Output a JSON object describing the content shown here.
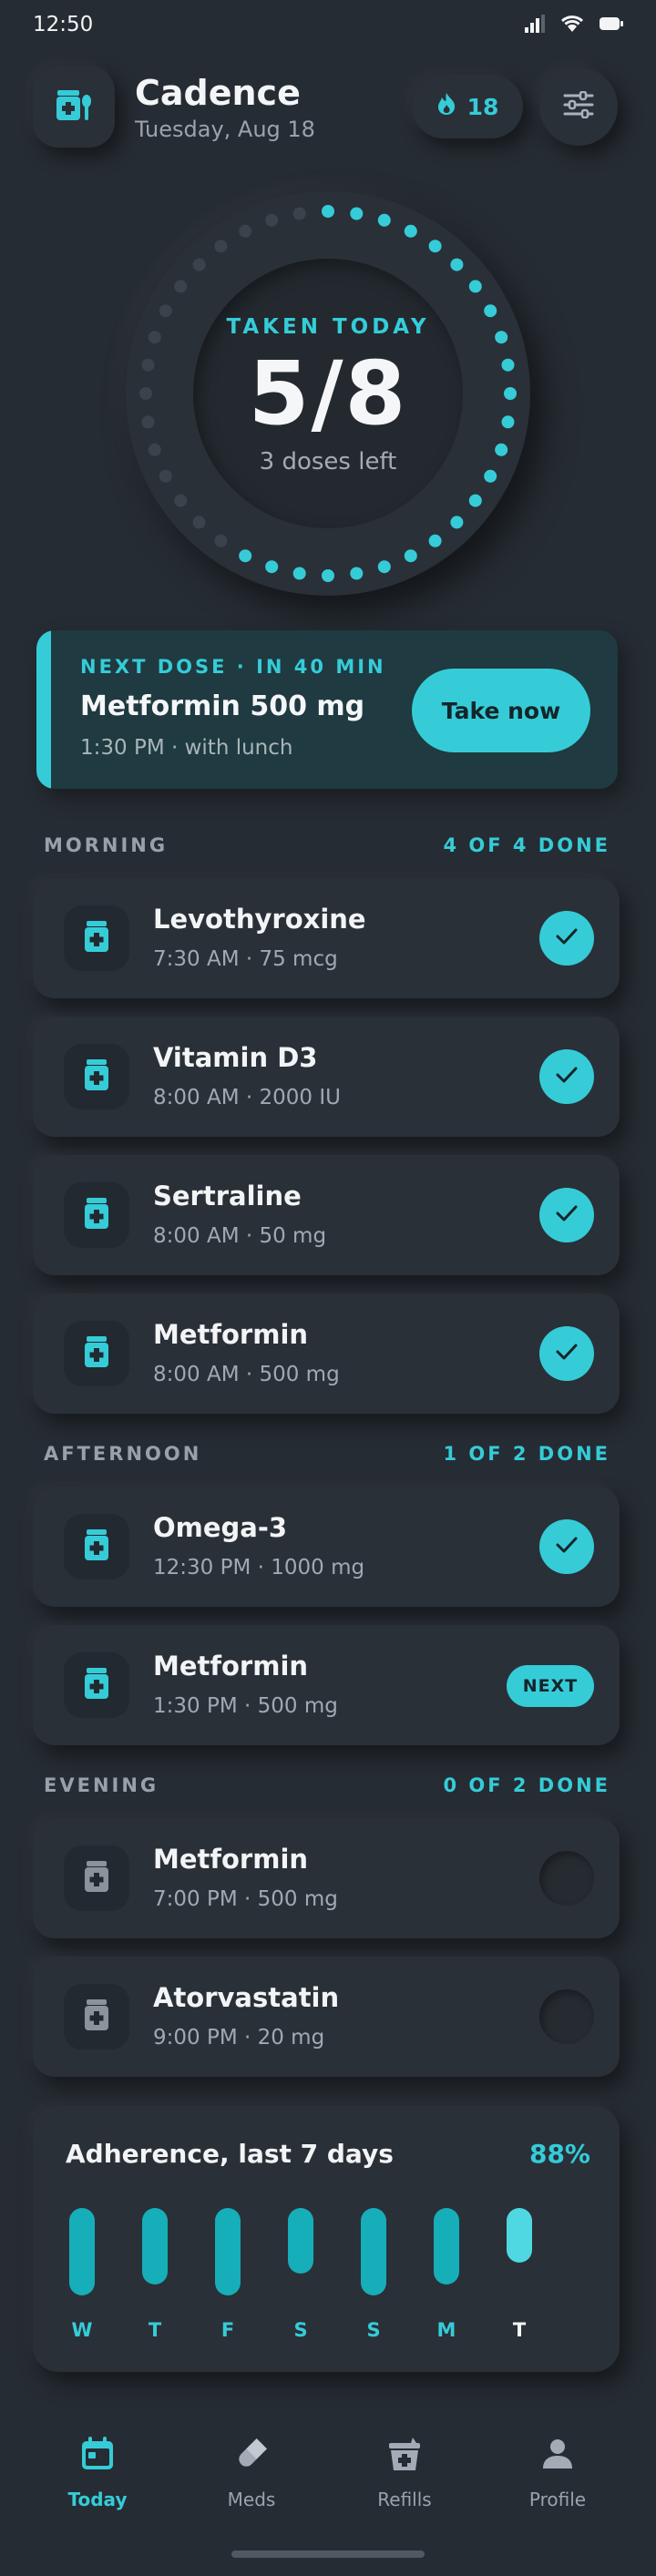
{
  "status": {
    "time": "12:50"
  },
  "header": {
    "title": "Cadence",
    "date": "Tuesday, Aug 18",
    "streak": "18"
  },
  "progress": {
    "label": "TAKEN TODAY",
    "count": "5/8",
    "taken": 5,
    "total": 8,
    "fraction": 0.6,
    "remaining": "3 doses left"
  },
  "next_dose": {
    "label": "NEXT DOSE · IN 40 MIN",
    "title": "Metformin 500 mg",
    "subtitle": "1:30 PM · with lunch",
    "action": "Take now"
  },
  "sections": [
    {
      "title": "MORNING",
      "count": "4 OF 4 DONE",
      "items": [
        {
          "name": "Levothyroxine",
          "detail": "7:30 AM · 75 mcg",
          "state": "done"
        },
        {
          "name": "Vitamin D3",
          "detail": "8:00 AM · 2000 IU",
          "state": "done"
        },
        {
          "name": "Sertraline",
          "detail": "8:00 AM · 50 mg",
          "state": "done"
        },
        {
          "name": "Metformin",
          "detail": "8:00 AM · 500 mg",
          "state": "done"
        }
      ]
    },
    {
      "title": "AFTERNOON",
      "count": "1 OF 2 DONE",
      "items": [
        {
          "name": "Omega-3",
          "detail": "12:30 PM · 1000 mg",
          "state": "done"
        },
        {
          "name": "Metformin",
          "detail": "1:30 PM · 500 mg",
          "state": "next",
          "badge": "NEXT"
        }
      ]
    },
    {
      "title": "EVENING",
      "count": "0 OF 2 DONE",
      "items": [
        {
          "name": "Metformin",
          "detail": "7:00 PM · 500 mg",
          "state": "pending"
        },
        {
          "name": "Atorvastatin",
          "detail": "9:00 PM · 20 mg",
          "state": "pending"
        }
      ]
    }
  ],
  "adherence": {
    "title": "Adherence, last 7 days",
    "percent": "88%",
    "days": [
      "W",
      "T",
      "F",
      "S",
      "S",
      "M",
      "T"
    ],
    "levels": [
      1.0,
      0.88,
      1.0,
      0.75,
      1.0,
      0.88,
      0.63
    ]
  },
  "nav": {
    "items": [
      {
        "label": "Today",
        "icon": "calendar-icon",
        "active": true
      },
      {
        "label": "Meds",
        "icon": "pill-icon",
        "active": false
      },
      {
        "label": "Refills",
        "icon": "refill-bottle-icon",
        "active": false
      },
      {
        "label": "Profile",
        "icon": "person-icon",
        "active": false
      }
    ]
  },
  "colors": {
    "accent": "#35ccd8",
    "background": "#262c33",
    "card": "#2a3038",
    "bar": "#16aeb9"
  }
}
